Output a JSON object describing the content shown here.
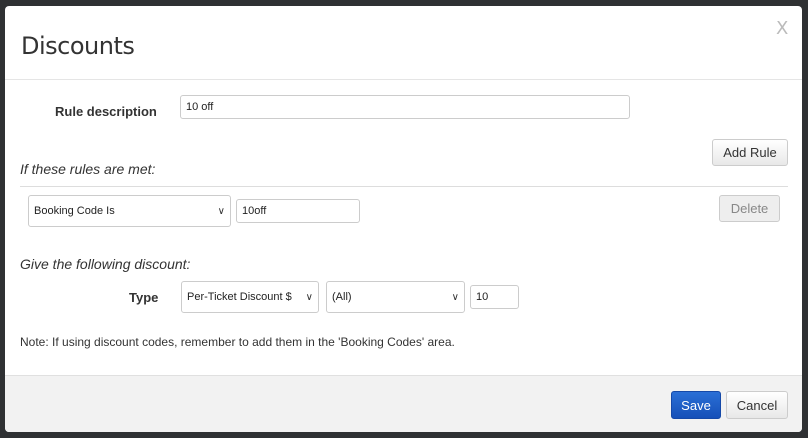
{
  "modal": {
    "title": "Discounts",
    "close_label": "X"
  },
  "rule": {
    "label": "Rule description",
    "value": "10 off"
  },
  "conditions": {
    "heading": "If these rules are met:",
    "add_rule_label": "Add Rule",
    "condition_type": "Booking Code Is",
    "condition_value": "10off",
    "delete_label": "Delete"
  },
  "discount": {
    "heading": "Give the following discount:",
    "type_label": "Type",
    "type_value": "Per-Ticket Discount $",
    "scope_value": "(All)",
    "amount": "10"
  },
  "note": "Note: If using discount codes, remember to add them in the 'Booking Codes' area.",
  "footer": {
    "save_label": "Save",
    "cancel_label": "Cancel"
  },
  "colors": {
    "primary": "#1a5dc8",
    "overlay": "#2f3133"
  }
}
